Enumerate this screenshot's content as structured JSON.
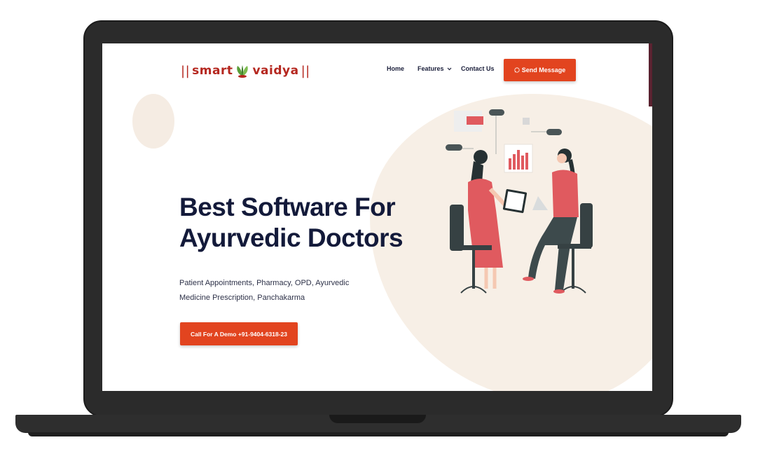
{
  "brand": {
    "part1": "smart",
    "part2": "vaidya",
    "color": "#b5271f"
  },
  "nav": {
    "home": "Home",
    "features": "Features",
    "contact": "Contact Us",
    "send_message": "Send Message"
  },
  "hero": {
    "title_line1": "Best Software For",
    "title_line2": "Ayurvedic Doctors",
    "subtitle": "Patient Appointments, Pharmacy, OPD, Ayurvedic Medicine Prescription, Panchakarma",
    "cta": "Call For A Demo +91-9404-6318-23"
  },
  "icons": {
    "features_dropdown": "chevron-down-icon",
    "send_message": "whatsapp-icon",
    "logo_leaf": "leaf-icon"
  },
  "colors": {
    "accent": "#e2441f",
    "heading": "#131a3a",
    "blob": "#f7efe6"
  }
}
